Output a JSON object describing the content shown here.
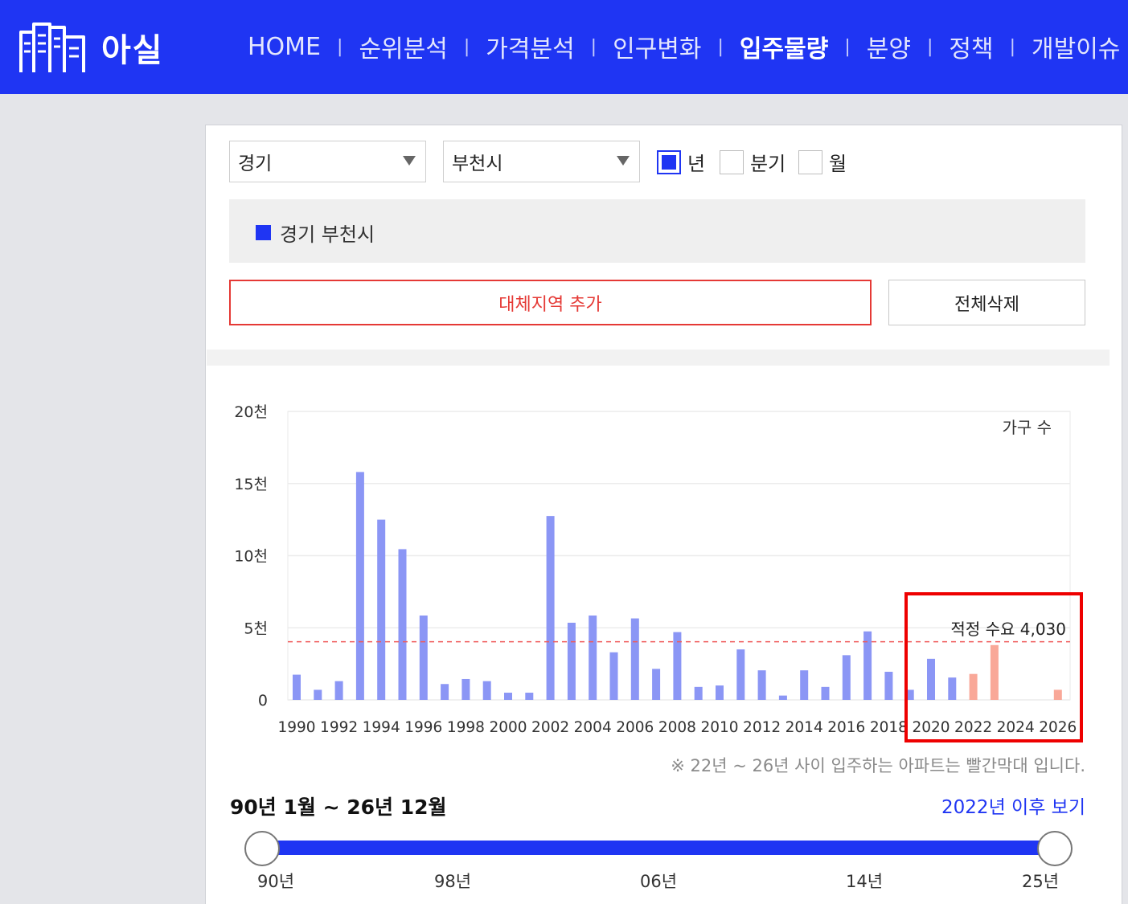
{
  "header": {
    "logo_text": "아실",
    "nav": [
      {
        "label": "HOME",
        "active": false
      },
      {
        "label": "순위분석",
        "active": false
      },
      {
        "label": "가격분석",
        "active": false
      },
      {
        "label": "인구변화",
        "active": false
      },
      {
        "label": "입주물량",
        "active": true
      },
      {
        "label": "분양",
        "active": false
      },
      {
        "label": "정책",
        "active": false
      },
      {
        "label": "개발이슈",
        "active": false
      }
    ],
    "nav_separator": "|"
  },
  "filters": {
    "province": "경기",
    "city": "부천시",
    "period_options": [
      {
        "label": "년",
        "checked": true
      },
      {
        "label": "분기",
        "checked": false
      },
      {
        "label": "월",
        "checked": false
      }
    ]
  },
  "legend": {
    "label": "경기 부천시",
    "color": "#1f35f3"
  },
  "buttons": {
    "add_region": "대체지역 추가",
    "delete_all": "전체삭제"
  },
  "chart_data": {
    "type": "bar",
    "unit_label": "가구 수",
    "y_ticks": [
      "0",
      "5천",
      "10천",
      "15천",
      "20천"
    ],
    "ylim": [
      0,
      20000
    ],
    "x_tick_labels": [
      "1990",
      "1992",
      "1994",
      "1996",
      "1998",
      "2000",
      "2002",
      "2004",
      "2006",
      "2008",
      "2010",
      "2012",
      "2014",
      "2016",
      "2018",
      "2020",
      "2022",
      "2024",
      "2026"
    ],
    "categories": [
      "1990",
      "1991",
      "1992",
      "1993",
      "1994",
      "1995",
      "1996",
      "1997",
      "1998",
      "1999",
      "2000",
      "2001",
      "2002",
      "2003",
      "2004",
      "2005",
      "2006",
      "2007",
      "2008",
      "2009",
      "2010",
      "2011",
      "2012",
      "2013",
      "2014",
      "2015",
      "2016",
      "2017",
      "2018",
      "2019",
      "2020",
      "2021",
      "2022",
      "2023",
      "2024",
      "2025",
      "2026"
    ],
    "values": [
      1750,
      700,
      1300,
      15800,
      12500,
      10450,
      5850,
      1100,
      1450,
      1300,
      500,
      500,
      12750,
      5350,
      5850,
      3300,
      5650,
      2150,
      4700,
      900,
      1000,
      3500,
      2050,
      300,
      2050,
      900,
      3100,
      4750,
      1950,
      700,
      2850,
      1550,
      1800,
      3800,
      0,
      0,
      700
    ],
    "series_colors": {
      "past": "#8b96f5",
      "future": "#f9a898"
    },
    "future_from": "2022",
    "reference_line": {
      "label": "적정 수요 4,030",
      "value": 4030,
      "color": "#f05a5a"
    },
    "grid": true
  },
  "note": "※ 22년 ~ 26년 사이 입주하는 아파트는 빨간막대 입니다.",
  "range": {
    "label": "90년 1월 ~ 26년 12월",
    "after_link": "2022년 이후 보기",
    "ticks": [
      "90년",
      "98년",
      "06년",
      "14년",
      "25년"
    ]
  }
}
